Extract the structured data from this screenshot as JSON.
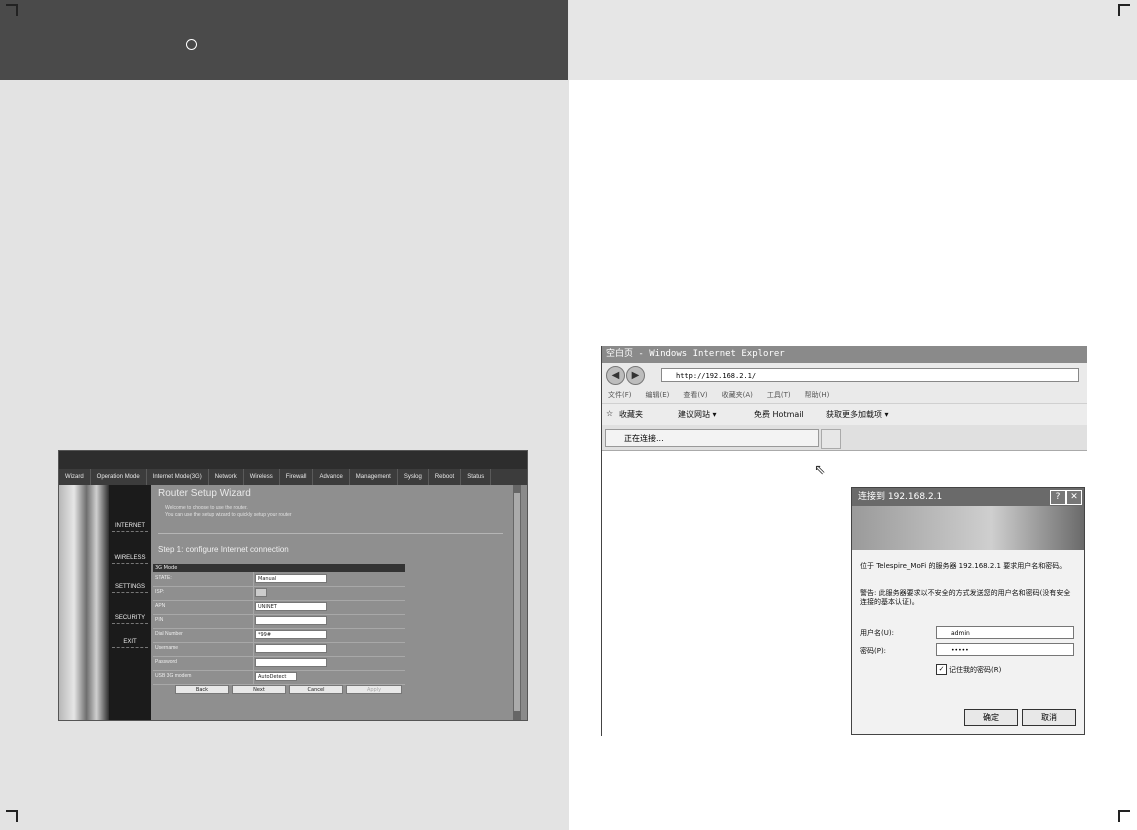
{
  "router": {
    "nav": [
      "Wizard",
      "Operation Mode",
      "Internet Mode(3G)",
      "Network",
      "Wireless",
      "Firewall",
      "Advance",
      "Management",
      "Syslog",
      "Reboot",
      "Status"
    ],
    "side": [
      "INTERNET",
      "WIRELESS",
      "SETTINGS",
      "SECURITY",
      "EXIT"
    ],
    "title": "Router Setup Wizard",
    "intro1": "Welcome to choose to use the router.",
    "intro2": "You can use the setup wizard to quickly setup your router",
    "step": "Step 1: configure Internet connection",
    "form_header": "3G Mode",
    "fields": [
      {
        "label": "STATE:",
        "value": "Manual"
      },
      {
        "label": "ISP:",
        "value": ""
      },
      {
        "label": "APN",
        "value": "UNINET"
      },
      {
        "label": "PIN",
        "value": ""
      },
      {
        "label": "Dial Number",
        "value": "*99#"
      },
      {
        "label": "Username",
        "value": ""
      },
      {
        "label": "Password",
        "value": ""
      },
      {
        "label": "USB 3G modem",
        "value": "AutoDetect"
      }
    ],
    "buttons": [
      "Back",
      "Next",
      "Cancel",
      "Apply"
    ]
  },
  "ie": {
    "title": "空白页 - Windows Internet Explorer",
    "address": "http://192.168.2.1/",
    "menu": [
      "文件(F)",
      "编辑(E)",
      "查看(V)",
      "收藏夹(A)",
      "工具(T)",
      "帮助(H)"
    ],
    "fav_label": "收藏夹",
    "fav_links": [
      "建议网站 ▾",
      "免费 Hotmail",
      "获取更多加载项 ▾"
    ],
    "tab_label": "正在连接..."
  },
  "dialog": {
    "title": "连接到 192.168.2.1",
    "message": "位于 Telespire_MoFi 的服务器 192.168.2.1 要求用户名和密码。",
    "warning": "警告: 此服务器要求以不安全的方式发送您的用户名和密码(没有安全连接的基本认证)。",
    "user_label": "用户名(U):",
    "user_value": "admin",
    "pass_label": "密码(P):",
    "pass_value": "•••••",
    "remember": "记住我的密码(R)",
    "ok": "确定",
    "cancel": "取消"
  }
}
